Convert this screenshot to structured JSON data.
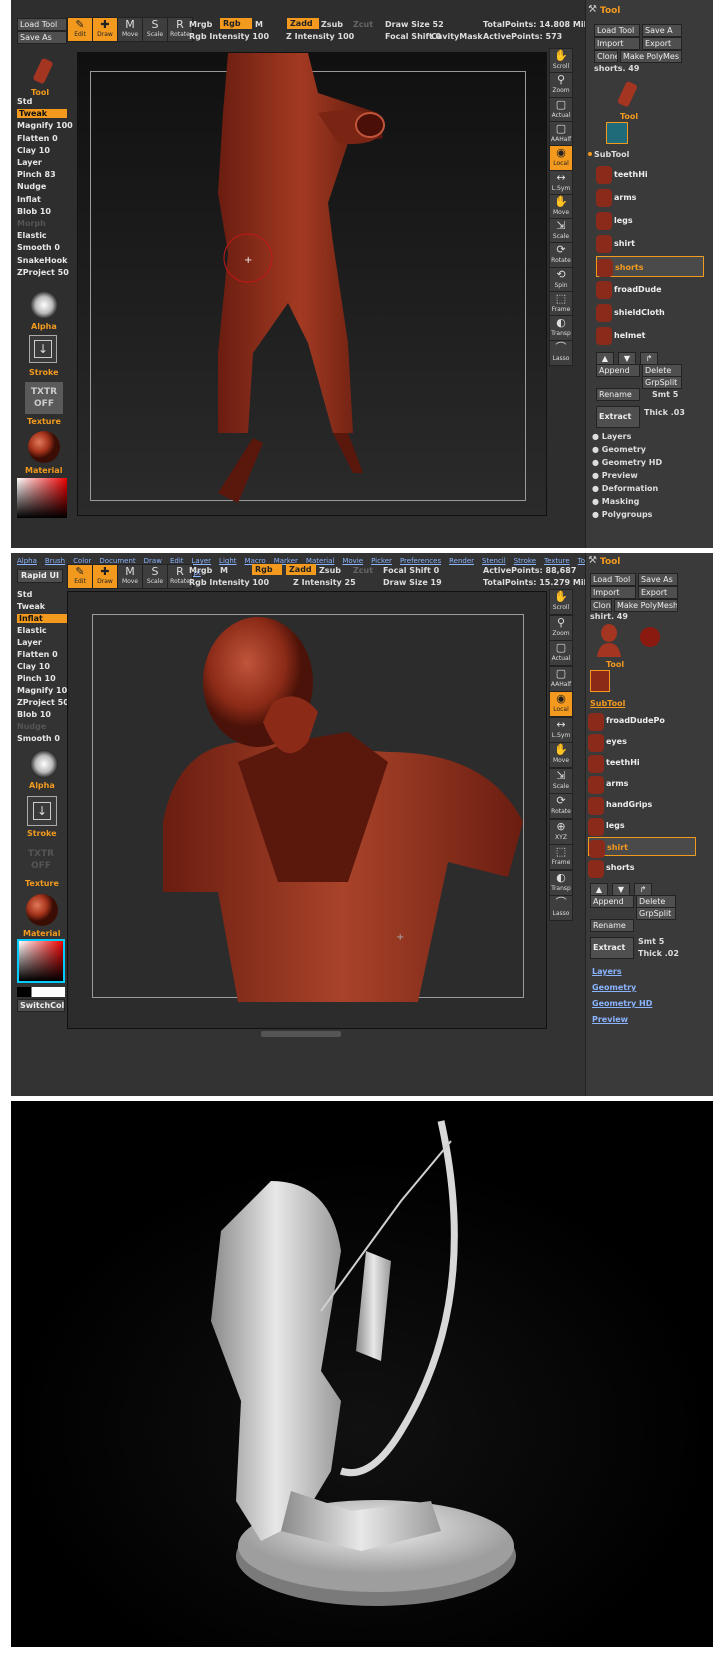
{
  "p1": {
    "left_top": {
      "load_tool": "Load Tool",
      "save_as": "Save As"
    },
    "tools": [
      {
        "name": "edit",
        "label": "Edit",
        "glyph": "✎",
        "on": true
      },
      {
        "name": "draw",
        "label": "Draw",
        "glyph": "✚",
        "on": true
      },
      {
        "name": "move",
        "label": "Move",
        "glyph": "M",
        "on": false
      },
      {
        "name": "scale",
        "label": "Scale",
        "glyph": "S",
        "on": false
      },
      {
        "name": "rotate",
        "label": "Rotate",
        "glyph": "R",
        "on": false
      }
    ],
    "top": {
      "mrgb": "Mrgb",
      "rgb": "Rgb",
      "m": "M",
      "zadd": "Zadd",
      "zsub": "Zsub",
      "zcut": "Zcut",
      "rgb_intensity": "Rgb Intensity 100",
      "z_intensity": "Z Intensity 100",
      "draw_size": "Draw Size 52",
      "focal_shift": "Focal Shift 0",
      "cavity_mask": "CavityMask",
      "total_points": "TotalPoints: 14.808 Mil",
      "active_points": "ActivePoints: 573"
    },
    "brushes": [
      "Std",
      "Tweak",
      "Magnify 100",
      "Flatten 0",
      "Clay 10",
      "Layer",
      "Pinch 83",
      "Nudge",
      "Inflat",
      "Blob 10",
      "Morph",
      "Elastic",
      "Smooth 0",
      "SnakeHook",
      "ZProject 50"
    ],
    "selected_brush": "Tweak",
    "side_labels": {
      "tool": "Tool",
      "alpha": "Alpha",
      "stroke": "Stroke",
      "texture_tile": "TXTR OFF",
      "texture": "Texture",
      "material": "Material"
    },
    "right_icons": [
      {
        "name": "scroll",
        "label": "Scroll",
        "glyph": "✋"
      },
      {
        "name": "zoom",
        "label": "Zoom",
        "glyph": "⚲"
      },
      {
        "name": "actual",
        "label": "Actual",
        "glyph": "▢"
      },
      {
        "name": "aahalf",
        "label": "AAHalf",
        "glyph": "▢"
      },
      {
        "name": "local",
        "label": "Local",
        "glyph": "◉",
        "on": true
      },
      {
        "name": "lsym",
        "label": "L.Sym",
        "glyph": "↔"
      },
      {
        "name": "move",
        "label": "Move",
        "glyph": "✋"
      },
      {
        "name": "scale",
        "label": "Scale",
        "glyph": "⇲"
      },
      {
        "name": "rotate",
        "label": "Rotate",
        "glyph": "⟳"
      },
      {
        "name": "spin",
        "label": "Spin",
        "glyph": "⟲"
      },
      {
        "name": "frame",
        "label": "Frame",
        "glyph": "⬚"
      },
      {
        "name": "transp",
        "label": "Transp",
        "glyph": "◐"
      },
      {
        "name": "lasso",
        "label": "Lasso",
        "glyph": "⌒"
      }
    ],
    "panel": {
      "title": "Tool",
      "buttons": [
        "Load Tool",
        "Save A",
        "Import",
        "Export",
        "Clone",
        "Make PolyMes"
      ],
      "current": "shorts. 49",
      "tool_label": "Tool",
      "subtool_title": "SubTool",
      "subtools": [
        "teethHi",
        "arms",
        "legs",
        "shirt",
        "shorts",
        "froadDude",
        "shieldCloth",
        "helmet"
      ],
      "selected_subtool": "shorts",
      "actions": [
        "Append",
        "Delete",
        "GrpSplit",
        "Rename",
        "Smt",
        "Extract",
        "Thick"
      ],
      "smt_value": "5",
      "thick_value": ".03",
      "sections": [
        "Layers",
        "Geometry",
        "Geometry HD",
        "Preview",
        "Deformation",
        "Masking",
        "Polygroups"
      ]
    }
  },
  "p2": {
    "menu": [
      "Alpha",
      "Brush",
      "Color",
      "Document",
      "Draw",
      "Edit",
      "Layer",
      "Light",
      "Macro",
      "Marker",
      "Material",
      "Movie",
      "Picker",
      "Preferences",
      "Render",
      "Stencil",
      "Stroke",
      "Texture",
      "Tool"
    ],
    "menu2": [
      "Transform",
      "Zoom",
      "Zplugin",
      "Zscript"
    ],
    "rapid_ui": "Rapid UI",
    "tools": [
      {
        "name": "edit",
        "label": "Edit",
        "glyph": "✎",
        "on": true
      },
      {
        "name": "draw",
        "label": "Draw",
        "glyph": "✚",
        "on": true
      },
      {
        "name": "move",
        "label": "Move",
        "glyph": "M",
        "on": false
      },
      {
        "name": "scale",
        "label": "Scale",
        "glyph": "S",
        "on": false
      },
      {
        "name": "rotate",
        "label": "Rotate",
        "glyph": "R",
        "on": false
      }
    ],
    "top": {
      "mrgb": "Mrgb",
      "rgb": "Rgb",
      "m": "M",
      "zadd": "Zadd",
      "zsub": "Zsub",
      "zcut": "Zcut",
      "rgb_intensity": "Rgb Intensity 100",
      "z_intensity": "Z Intensity 25",
      "focal_shift": "Focal Shift 0",
      "draw_size": "Draw Size 19",
      "active_points": "ActivePoints: 88,687",
      "total_points": "TotalPoints: 15.279 Mil"
    },
    "brushes": [
      "Std",
      "Tweak",
      "Inflat",
      "Elastic",
      "Layer",
      "Flatten 0",
      "Clay 10",
      "Pinch 10",
      "Magnify 100",
      "ZProject 50",
      "Blob 10",
      "Nudge",
      "Smooth 0"
    ],
    "selected_brush": "Inflat",
    "side_labels": {
      "alpha": "Alpha",
      "stroke": "Stroke",
      "texture_tile": "TXTR OFF",
      "texture": "Texture",
      "material": "Material",
      "switch_color": "SwitchColor"
    },
    "right_icons": [
      {
        "name": "scroll",
        "label": "Scroll",
        "glyph": "✋"
      },
      {
        "name": "zoom",
        "label": "Zoom",
        "glyph": "⚲"
      },
      {
        "name": "actual",
        "label": "Actual",
        "glyph": "▢"
      },
      {
        "name": "aahalf",
        "label": "AAHalf",
        "glyph": "▢"
      },
      {
        "name": "local",
        "label": "Local",
        "glyph": "◉",
        "on": true
      },
      {
        "name": "lsym",
        "label": "L.Sym",
        "glyph": "↔"
      },
      {
        "name": "move",
        "label": "Move",
        "glyph": "✋"
      },
      {
        "name": "scale",
        "label": "Scale",
        "glyph": "⇲"
      },
      {
        "name": "rotate",
        "label": "Rotate",
        "glyph": "⟳"
      },
      {
        "name": "xyz",
        "label": "XYZ",
        "glyph": "⊕"
      },
      {
        "name": "frame",
        "label": "Frame",
        "glyph": "⬚"
      },
      {
        "name": "transp",
        "label": "Transp",
        "glyph": "◐"
      },
      {
        "name": "lasso",
        "label": "Lasso",
        "glyph": "⌒"
      }
    ],
    "panel": {
      "title": "Tool",
      "buttons": [
        "Load Tool",
        "Save As",
        "Import",
        "Export",
        "Clone",
        "Make PolyMesh3"
      ],
      "current": "shirt. 49",
      "tool_label": "Tool",
      "subtool_title": "SubTool",
      "subtools": [
        "froadDudePo",
        "eyes",
        "teethHi",
        "arms",
        "handGrips",
        "legs",
        "shirt",
        "shorts"
      ],
      "selected_subtool": "shirt",
      "actions": [
        "Append",
        "Delete",
        "GrpSplit",
        "Rename",
        "Extract",
        "Smt",
        "Thick"
      ],
      "smt_value": "5",
      "thick_value": ".02",
      "sections": [
        "Layers",
        "Geometry",
        "Geometry HD",
        "Preview"
      ]
    }
  }
}
